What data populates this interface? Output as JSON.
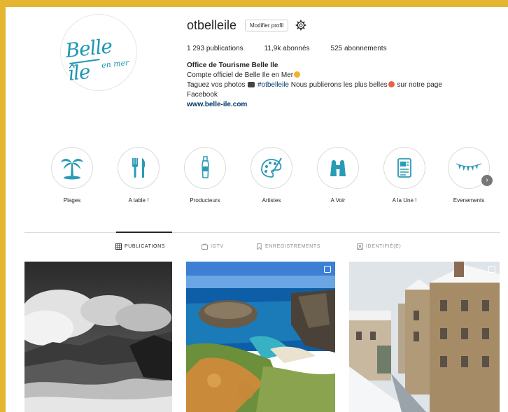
{
  "profile": {
    "username": "otbelleile",
    "edit_label": "Modifier profil",
    "avatar_logo": {
      "main": "Belle île",
      "sub": "en mer"
    },
    "stats": {
      "posts_count": "1 293",
      "posts_label": "publications",
      "followers_count": "11,9k",
      "followers_label": "abonnés",
      "following_count": "525",
      "following_label": "abonnements"
    },
    "bio": {
      "name": "Office de Tourisme Belle Ile",
      "line1": "Compte officiel de Belle Ile en Mer",
      "line2_start": "Taguez vos photos",
      "hashtag": "#otbelleile",
      "line2_end": "Nous publierons les plus belles",
      "line2_tail": "sur notre page",
      "line3": "Facebook",
      "website": "www.belle-ile.com"
    }
  },
  "highlights": [
    {
      "label": "Plages",
      "icon": "palm-tree-icon"
    },
    {
      "label": "A table !",
      "icon": "fork-knife-icon"
    },
    {
      "label": "Producteurs",
      "icon": "bottle-icon"
    },
    {
      "label": "Artistes",
      "icon": "palette-icon"
    },
    {
      "label": "A Voir",
      "icon": "binoculars-icon"
    },
    {
      "label": "A la Une !",
      "icon": "newspaper-icon"
    },
    {
      "label": "Evenements",
      "icon": "bunting-icon"
    }
  ],
  "tabs": [
    {
      "label": "PUBLICATIONS",
      "icon": "grid-icon",
      "active": true
    },
    {
      "label": "IGTV",
      "icon": "igtv-icon",
      "active": false
    },
    {
      "label": "ENREGISTREMENTS",
      "icon": "bookmark-icon",
      "active": false
    },
    {
      "label": "IDENTIFIÉ(E)",
      "icon": "tagged-icon",
      "active": false
    }
  ],
  "colors": {
    "background_frame": "#e4b531",
    "brand_teal": "#1d97b3",
    "link": "#00376b",
    "muted": "#8e8e8e"
  }
}
